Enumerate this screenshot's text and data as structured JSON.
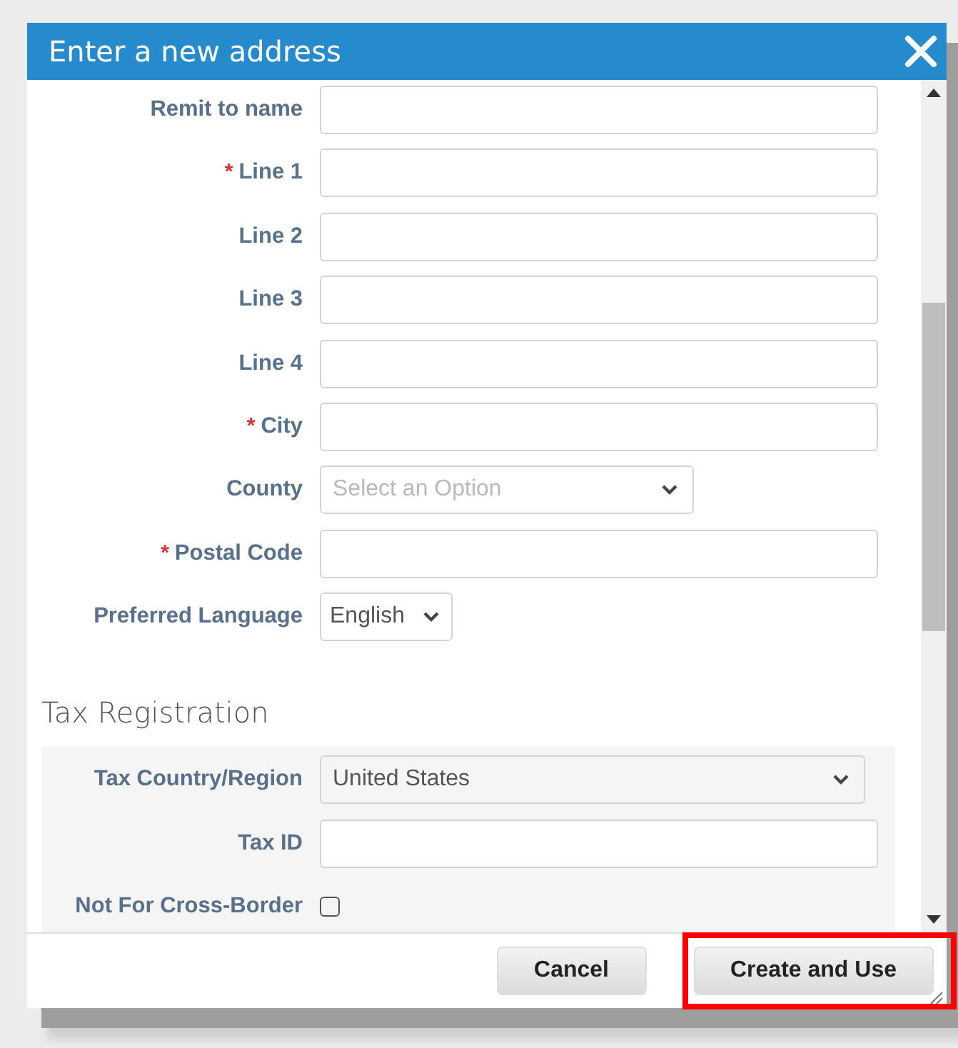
{
  "dialog": {
    "title": "Enter a new address"
  },
  "fields": [
    {
      "label": "Remit to name",
      "kind": "text"
    },
    {
      "label": "Line 1",
      "required_mark": "*",
      "kind": "text"
    },
    {
      "label": "Line 2",
      "kind": "text"
    },
    {
      "label": "Line 3",
      "kind": "text"
    },
    {
      "label": "Line 4",
      "kind": "text"
    },
    {
      "label": "City",
      "required_mark": "*",
      "kind": "text"
    },
    {
      "label": "County",
      "kind": "dropdown",
      "placeholder": "Select an Option"
    },
    {
      "label": "Postal Code",
      "required_mark": "*",
      "kind": "text"
    },
    {
      "label": "Preferred Language",
      "kind": "small-dropdown",
      "value": "English"
    }
  ],
  "tax_section": {
    "title": "Tax Registration",
    "fields": [
      {
        "label": "Tax Country/Region",
        "kind": "wide-dropdown",
        "value": "United States"
      },
      {
        "label": "Tax ID",
        "kind": "text"
      },
      {
        "label": "Not For Cross-Border",
        "kind": "checkbox",
        "checked": false
      }
    ]
  },
  "buttons": [
    {
      "label": "Cancel",
      "highlighted": false
    },
    {
      "label": "Create and Use",
      "highlighted": true
    }
  ]
}
